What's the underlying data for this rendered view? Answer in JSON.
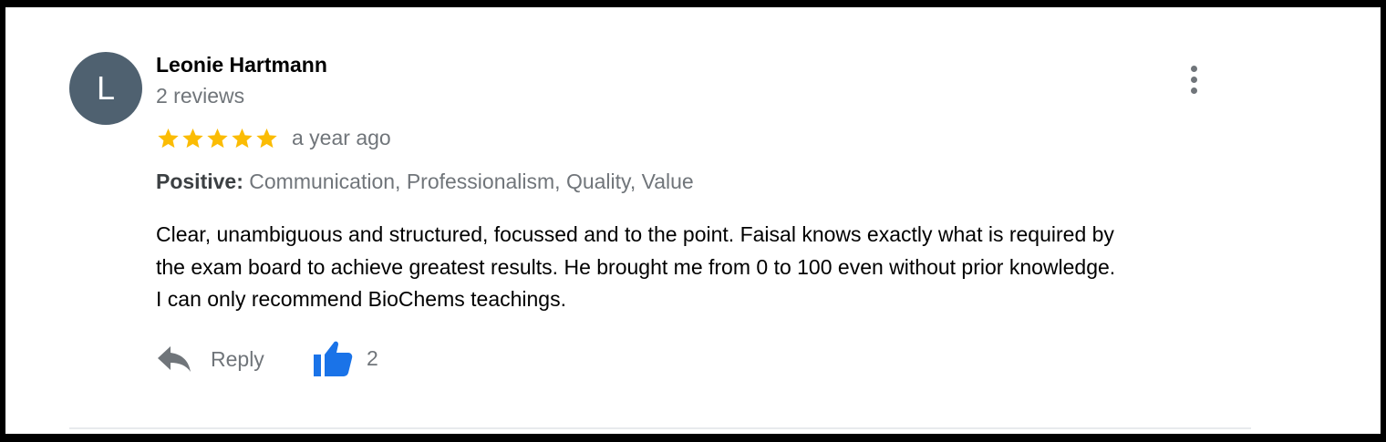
{
  "review": {
    "avatar_letter": "L",
    "reviewer_name": "Leonie Hartmann",
    "review_count": "2 reviews",
    "rating": 5,
    "max_rating": 5,
    "time": "a year ago",
    "attributes_label": "Positive:",
    "attributes_value": " Communication, Professionalism, Quality, Value",
    "text_lines": [
      "Clear, unambiguous and structured, focussed and to the point. Faisal knows exactly what is required by",
      "the exam board to achieve greatest results. He brought me from 0 to 100  even without prior knowledge.",
      "I can only recommend BioChems teachings."
    ],
    "reply_label": "Reply",
    "like_count": "2"
  },
  "colors": {
    "avatar_bg": "#4f6170",
    "star": "#fbbc04",
    "like_icon": "#1a73e8",
    "secondary_text": "#70757a",
    "primary_text": "#000000"
  },
  "icons": {
    "more": "more-vert-icon",
    "star": "star-icon",
    "reply": "reply-icon",
    "like": "thumb-up-icon"
  }
}
